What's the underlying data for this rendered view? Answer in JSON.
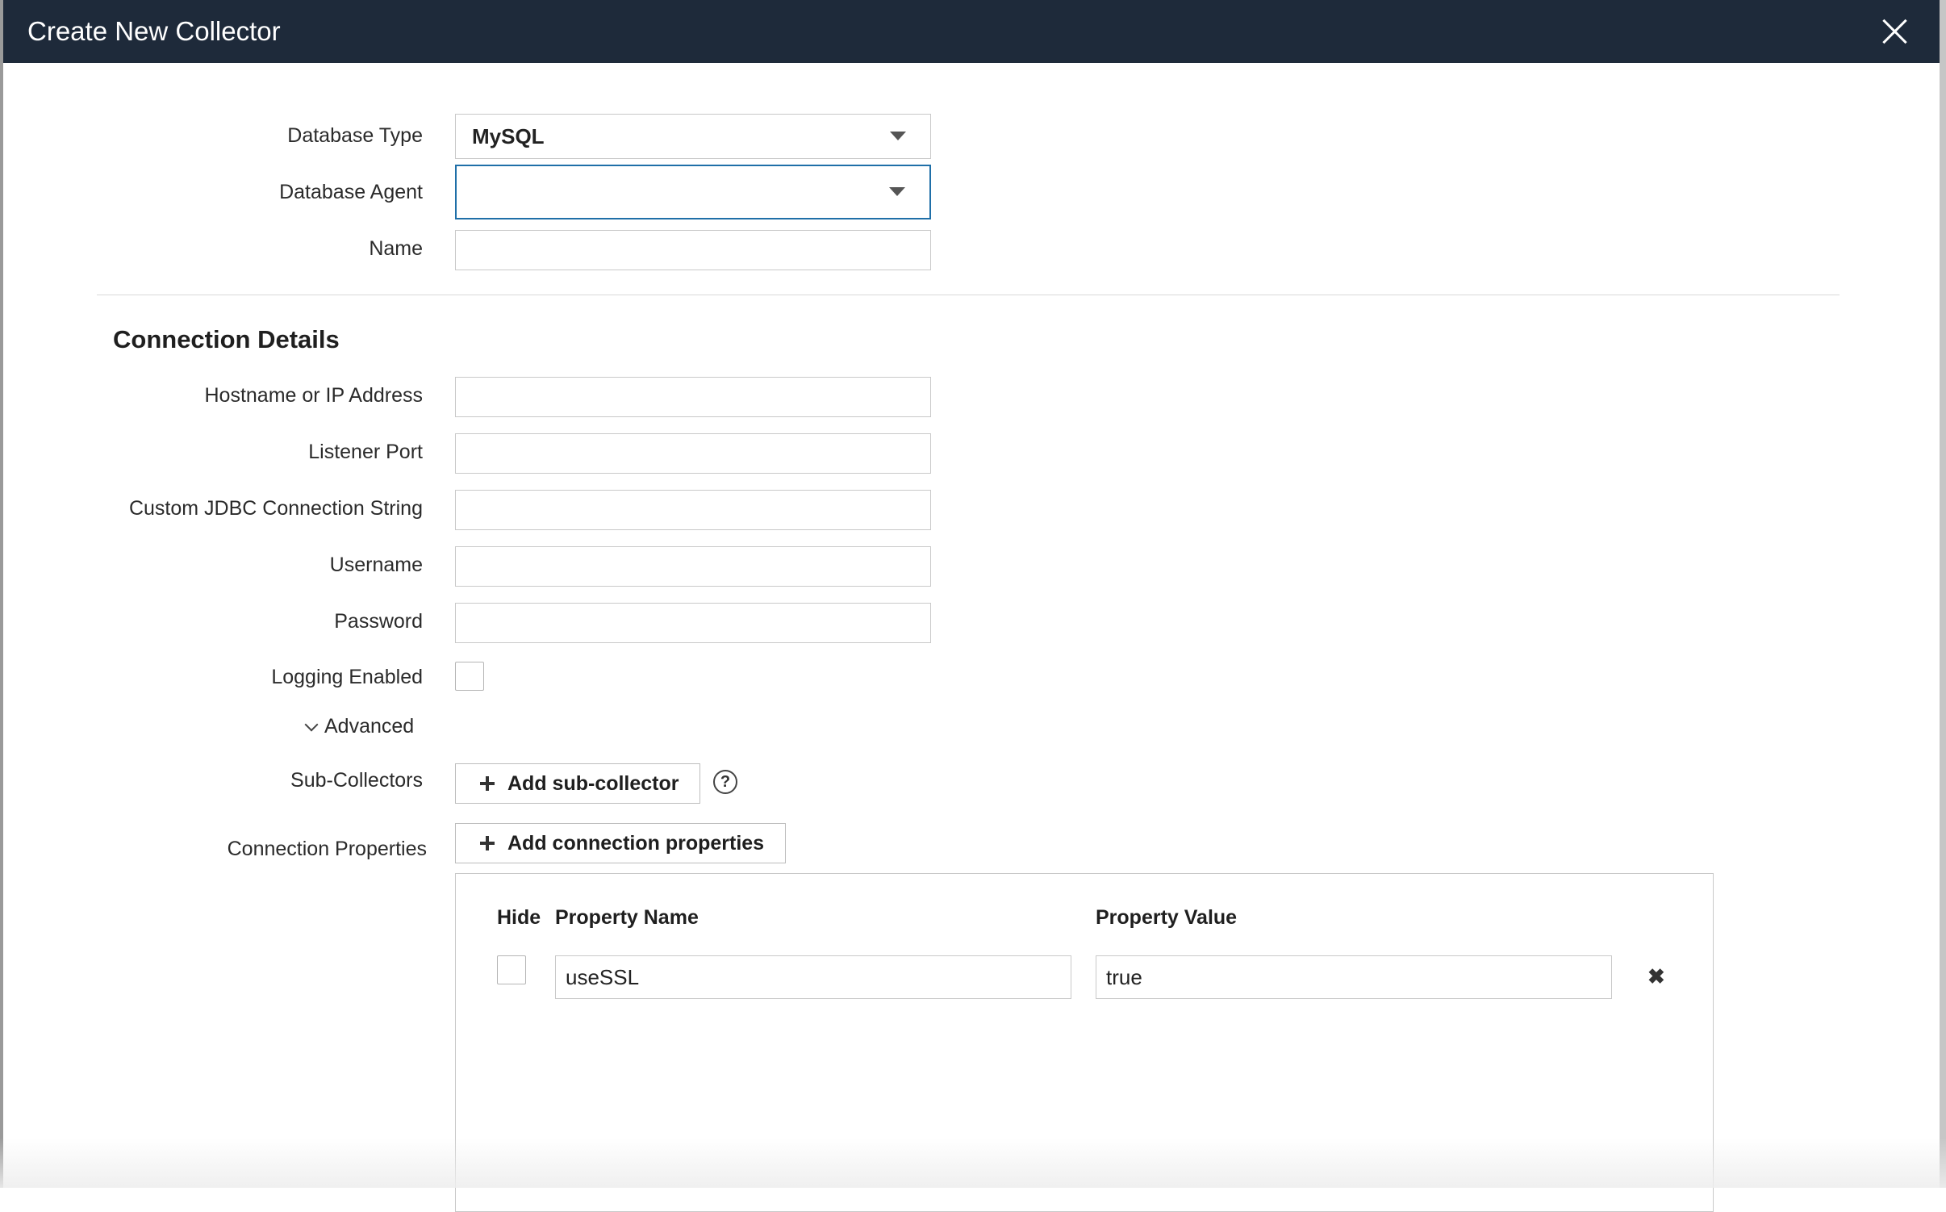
{
  "dialog": {
    "title": "Create New Collector",
    "close_label": "×"
  },
  "form": {
    "database_type": {
      "label": "Database Type",
      "value": "MySQL"
    },
    "database_agent": {
      "label": "Database Agent",
      "value": ""
    },
    "name": {
      "label": "Name",
      "value": ""
    }
  },
  "connection": {
    "title": "Connection Details",
    "hostname": {
      "label": "Hostname or IP Address",
      "value": ""
    },
    "port": {
      "label": "Listener Port",
      "value": ""
    },
    "jdbc": {
      "label": "Custom JDBC Connection String",
      "value": ""
    },
    "username": {
      "label": "Username",
      "value": ""
    },
    "password": {
      "label": "Password",
      "value": ""
    },
    "logging": {
      "label": "Logging Enabled",
      "checked": false
    }
  },
  "advanced": {
    "toggle_label": "Advanced",
    "sub_collectors": {
      "label": "Sub-Collectors",
      "button_label": "Add sub-collector",
      "help_label": "?"
    },
    "connection_properties": {
      "label": "Connection Properties",
      "button_label": "Add connection properties",
      "columns": {
        "hide": "Hide",
        "name": "Property Name",
        "value": "Property Value"
      },
      "rows": [
        {
          "hidden": false,
          "name": "useSSL",
          "value": "true"
        }
      ],
      "remove_label": "✖"
    }
  },
  "colors": {
    "titlebar": "#1e2a3a",
    "focus": "#1f6fa8",
    "border": "#c9c9c9"
  }
}
